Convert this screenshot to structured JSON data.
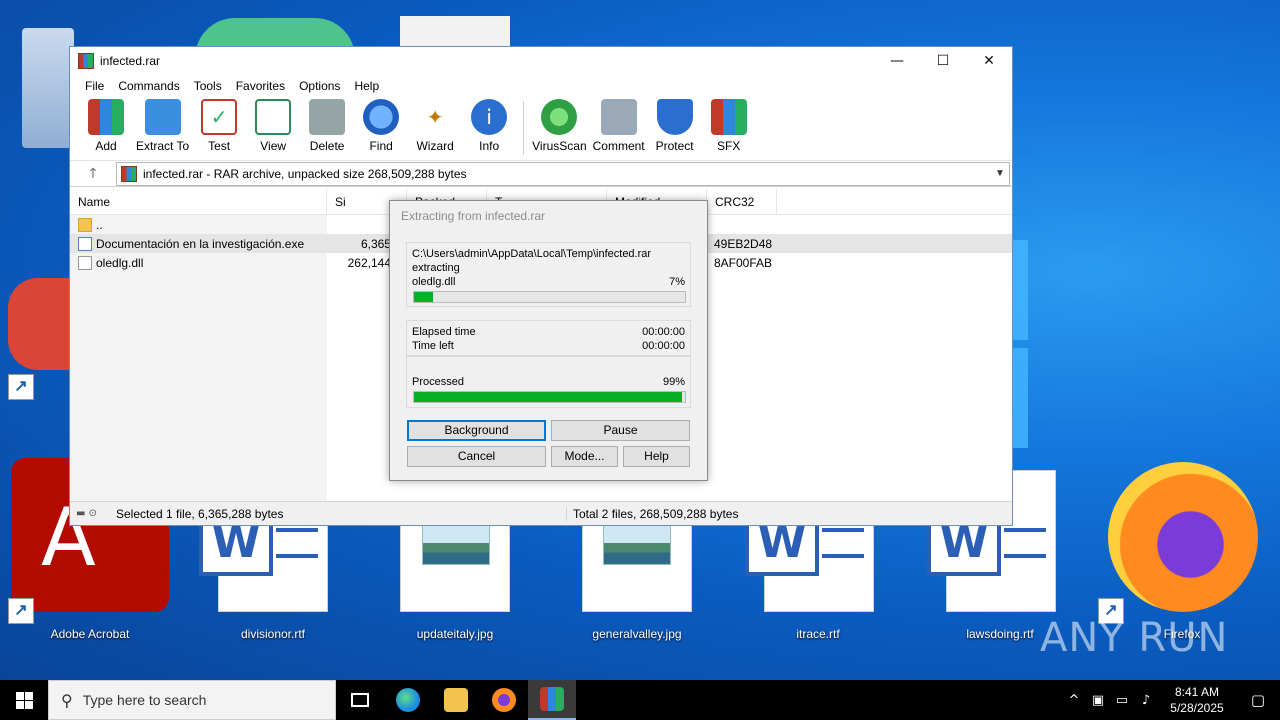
{
  "window": {
    "title": "infected.rar"
  },
  "menu": [
    "File",
    "Commands",
    "Tools",
    "Favorites",
    "Options",
    "Help"
  ],
  "toolbar": [
    {
      "label": "Add",
      "icon": "add-icon",
      "color": "#d8472b"
    },
    {
      "label": "Extract To",
      "icon": "extract-to-icon",
      "color": "#3b8ee0"
    },
    {
      "label": "Test",
      "icon": "test-icon",
      "color": "#c0392b"
    },
    {
      "label": "View",
      "icon": "view-icon",
      "color": "#2e8b57"
    },
    {
      "label": "Delete",
      "icon": "delete-icon",
      "color": "#7f8c8d"
    },
    {
      "label": "Find",
      "icon": "find-icon",
      "color": "#2a6fd0"
    },
    {
      "label": "Wizard",
      "icon": "wizard-icon",
      "color": "#4a4a4a"
    },
    {
      "label": "Info",
      "icon": "info-icon",
      "color": "#2a6fd0"
    },
    {
      "label": "VirusScan",
      "icon": "virusscan-icon",
      "color": "#2ea043"
    },
    {
      "label": "Comment",
      "icon": "comment-icon",
      "color": "#7f8fa6"
    },
    {
      "label": "Protect",
      "icon": "protect-icon",
      "color": "#2a6fd0"
    },
    {
      "label": "SFX",
      "icon": "sfx-icon",
      "color": "#d98a2b"
    }
  ],
  "address": {
    "text": "infected.rar - RAR archive, unpacked size 268,509,288 bytes"
  },
  "columns": {
    "name": "Name",
    "size": "Si",
    "packed": "Packed",
    "type": "T",
    "modified": "Modified",
    "crc": "CRC32"
  },
  "files": [
    {
      "name": "..",
      "size": "",
      "crc": "",
      "icon": "folder-icon"
    },
    {
      "name": "Documentación en la investigación.exe",
      "size": "6,365,2",
      "crc": "49EB2D48",
      "icon": "exe-icon"
    },
    {
      "name": "oledlg.dll",
      "size": "262,144,0",
      "crc": "8AF00FAB",
      "icon": "dll-icon"
    }
  ],
  "status": {
    "left": "Selected 1 file, 6,365,288 bytes",
    "right": "Total 2 files, 268,509,288 bytes"
  },
  "dialog": {
    "title": "Extracting from infected.rar",
    "path": "C:\\Users\\admin\\AppData\\Local\\Temp\\infected.rar",
    "action": "extracting",
    "file": "oledlg.dll",
    "file_percent_text": "7%",
    "file_progress": 0.07,
    "elapsed_label": "Elapsed time",
    "elapsed": "00:00:00",
    "left_label": "Time left",
    "left": "00:00:00",
    "processed_label": "Processed",
    "processed_percent_text": "99%",
    "processed_progress": 0.99,
    "buttons": {
      "background": "Background",
      "pause": "Pause",
      "cancel": "Cancel",
      "mode": "Mode...",
      "help": "Help"
    }
  },
  "desktop_icons": [
    {
      "label": "Adobe Acrobat"
    },
    {
      "label": "divisionor.rtf"
    },
    {
      "label": "updateitaly.jpg"
    },
    {
      "label": "generalvalley.jpg"
    },
    {
      "label": "itrace.rtf"
    },
    {
      "label": "lawsdoing.rtf"
    },
    {
      "label": "Firefox"
    }
  ],
  "watermark": "ANY RUN",
  "taskbar": {
    "search_placeholder": "Type here to search",
    "time": "8:41 AM",
    "date": "5/28/2025"
  }
}
